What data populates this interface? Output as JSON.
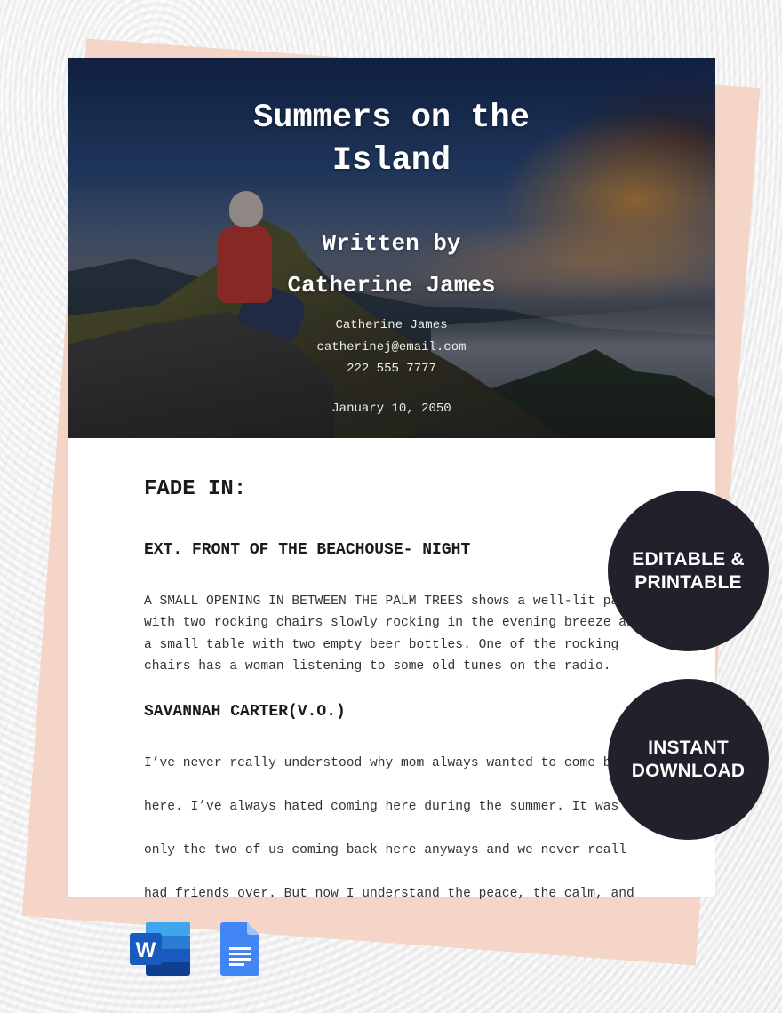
{
  "cover": {
    "title_line1": "Summers on the",
    "title_line2": "Island",
    "written_by": "Written by",
    "author_heading": "Catherine James",
    "contact_name": "Catherine James",
    "contact_email": "catherinej@email.com",
    "contact_phone": "222 555 7777",
    "date": "January 10, 2050"
  },
  "script": {
    "transition": "FADE IN:",
    "scene_heading": "EXT. FRONT OF THE BEACHOUSE- NIGHT",
    "action_lines": [
      "A SMALL OPENING IN BETWEEN THE PALM TREES shows a well-lit pa",
      "with two rocking chairs slowly rocking in the evening breeze an",
      "a small table with two empty beer bottles. One of the rocking",
      "chairs has a woman listening to some old tunes on the radio."
    ],
    "character": "SAVANNAH CARTER(V.O.)",
    "dialogue_lines": [
      "I’ve never really understood why mom always wanted to come ba",
      "here. I’ve always hated coming here during the summer. It was",
      "only the two of us coming back here anyways and we never reall",
      "had friends over. But now I understand the peace, the calm, and"
    ]
  },
  "badges": {
    "editable_line1": "EDITABLE &",
    "editable_line2": "PRINTABLE",
    "download_line1": "INSTANT",
    "download_line2": "DOWNLOAD"
  },
  "apps": {
    "word_letter": "W",
    "word_icon": "microsoft-word-icon",
    "docs_icon": "google-docs-icon"
  },
  "colors": {
    "badge_bg": "#22212b",
    "peach_accent": "#f4d5c7",
    "word_blue": "#185abd",
    "docs_blue": "#4285f4"
  }
}
